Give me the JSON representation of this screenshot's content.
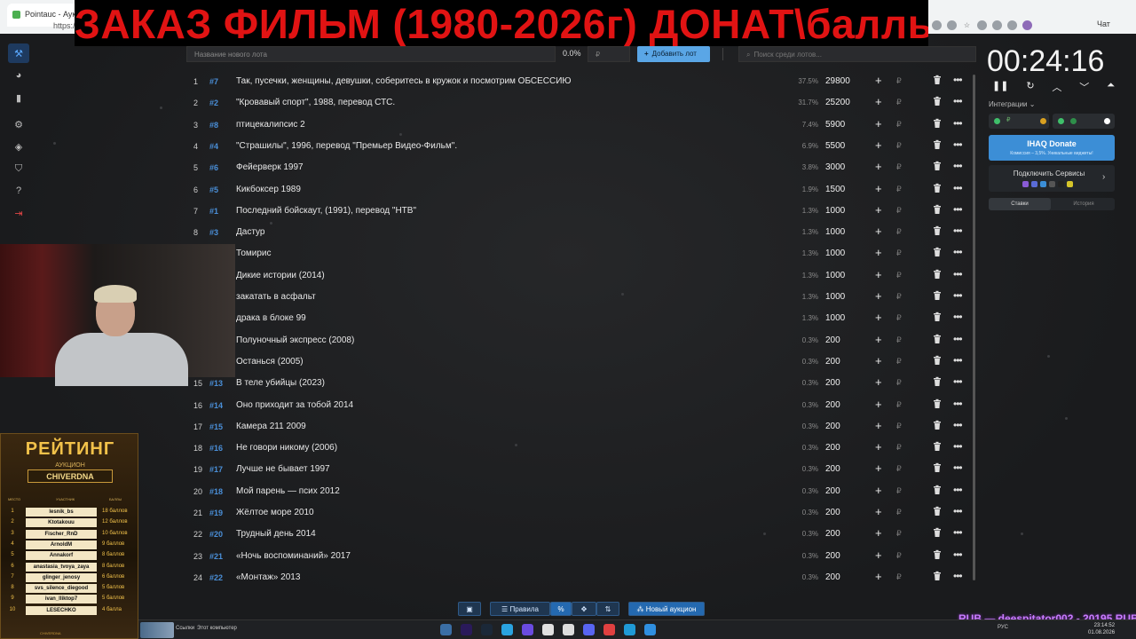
{
  "browser": {
    "tab_title": "Pointauc - Аукци",
    "url_fragment": "https://po",
    "chat_label": "Чат"
  },
  "banner": {
    "text": "ЗАКАЗ ФИЛЬМ (1980-2026г) ДОНАТ\\баллы"
  },
  "toolbar": {
    "lot_name_placeholder": "Название нового лота",
    "percent": "0.0%",
    "price_placeholder": "₽",
    "add_lot_label": "Добавить лот",
    "search_placeholder": "Поиск среди лотов..."
  },
  "lots": [
    {
      "num": "1",
      "fast_id": "#7",
      "name": "Так, пусечки, женщины, девушки, соберитесь в кружок и посмотрим ОБСЕССИЮ",
      "pct": "37.5%",
      "amount": "29800"
    },
    {
      "num": "2",
      "fast_id": "#2",
      "name": "\"Кровавый спорт\", 1988, перевод СТС.",
      "pct": "31.7%",
      "amount": "25200"
    },
    {
      "num": "3",
      "fast_id": "#8",
      "name": "птицекалипсис 2",
      "pct": "7.4%",
      "amount": "5900"
    },
    {
      "num": "4",
      "fast_id": "#4",
      "name": "\"Страшилы\", 1996, перевод \"Премьер Видео-Фильм\".",
      "pct": "6.9%",
      "amount": "5500"
    },
    {
      "num": "5",
      "fast_id": "#6",
      "name": "Фейерверк 1997",
      "pct": "3.8%",
      "amount": "3000"
    },
    {
      "num": "6",
      "fast_id": "#5",
      "name": "Кикбоксер 1989",
      "pct": "1.9%",
      "amount": "1500"
    },
    {
      "num": "7",
      "fast_id": "#1",
      "name": "Последний бойскаут, (1991), перевод \"НТВ\"",
      "pct": "1.3%",
      "amount": "1000"
    },
    {
      "num": "8",
      "fast_id": "#3",
      "name": "Дастур",
      "pct": "1.3%",
      "amount": "1000"
    },
    {
      "num": "",
      "fast_id": "",
      "name": "Томирис",
      "pct": "1.3%",
      "amount": "1000"
    },
    {
      "num": "",
      "fast_id": "",
      "name": "Дикие истории (2014)",
      "pct": "1.3%",
      "amount": "1000"
    },
    {
      "num": "",
      "fast_id": "",
      "name": "закатать в асфальт",
      "pct": "1.3%",
      "amount": "1000"
    },
    {
      "num": "",
      "fast_id": "",
      "name": "драка в блоке 99",
      "pct": "1.3%",
      "amount": "1000"
    },
    {
      "num": "",
      "fast_id": "",
      "name": "Полуночный экспресс (2008)",
      "pct": "0.3%",
      "amount": "200"
    },
    {
      "num": "",
      "fast_id": "",
      "name": "Останься (2005)",
      "pct": "0.3%",
      "amount": "200"
    },
    {
      "num": "15",
      "fast_id": "#13",
      "name": "В теле убийцы (2023)",
      "pct": "0.3%",
      "amount": "200"
    },
    {
      "num": "16",
      "fast_id": "#14",
      "name": "Оно приходит за тобой 2014",
      "pct": "0.3%",
      "amount": "200"
    },
    {
      "num": "17",
      "fast_id": "#15",
      "name": "Камера 211 2009",
      "pct": "0.3%",
      "amount": "200"
    },
    {
      "num": "18",
      "fast_id": "#16",
      "name": "Не говори никому (2006)",
      "pct": "0.3%",
      "amount": "200"
    },
    {
      "num": "19",
      "fast_id": "#17",
      "name": "Лучше не бывает 1997",
      "pct": "0.3%",
      "amount": "200"
    },
    {
      "num": "20",
      "fast_id": "#18",
      "name": "Мой парень — псих 2012",
      "pct": "0.3%",
      "amount": "200"
    },
    {
      "num": "21",
      "fast_id": "#19",
      "name": "Жёлтое море 2010",
      "pct": "0.3%",
      "amount": "200"
    },
    {
      "num": "22",
      "fast_id": "#20",
      "name": "Трудный день 2014",
      "pct": "0.3%",
      "amount": "200"
    },
    {
      "num": "23",
      "fast_id": "#21",
      "name": "«Ночь воспоминаний» 2017",
      "pct": "0.3%",
      "amount": "200"
    },
    {
      "num": "24",
      "fast_id": "#22",
      "name": "«Монтаж» 2013",
      "pct": "0.3%",
      "amount": "200"
    }
  ],
  "currency": "₽",
  "timer": "00:24:16",
  "integrations_label": "Интеграции",
  "donate": {
    "title": "IHAQ Donate",
    "subtitle": "Комиссия – 3,5%. Уникальные виджеты!"
  },
  "connect_services": "Подключить Сервисы",
  "right_tabs": [
    "Ставки",
    "История"
  ],
  "bottom": {
    "rules": "Правила",
    "new_auction": "Новый аукцион"
  },
  "rating": {
    "title": "РЕЙТИНГ",
    "subtitle": "АУКЦИОН",
    "channel": "CHIVERDNA",
    "headers": [
      "МЕСТО",
      "УЧАСТНИК",
      "БАЛЛЫ"
    ],
    "footer": "CHIVERDNA",
    "rows": [
      {
        "place": "1",
        "name": "lesnik_bs",
        "score": "18 баллов"
      },
      {
        "place": "2",
        "name": "Ktotakouu",
        "score": "12 баллов"
      },
      {
        "place": "3",
        "name": "Fischer_RnD",
        "score": "10 баллов"
      },
      {
        "place": "4",
        "name": "ArnoldM",
        "score": "9 баллов"
      },
      {
        "place": "5",
        "name": "Annakorf",
        "score": "8 баллов"
      },
      {
        "place": "6",
        "name": "anastasia_tvoya_zaya",
        "score": "8 баллов"
      },
      {
        "place": "7",
        "name": "glinger_jenosy",
        "score": "6 баллов"
      },
      {
        "place": "8",
        "name": "svs_silence_diegood",
        "score": "5 баллов"
      },
      {
        "place": "9",
        "name": "ivan_lliktop7",
        "score": "5 баллов"
      },
      {
        "place": "10",
        "name": "LESECHKO",
        "score": "4 балла"
      }
    ]
  },
  "overlay_donor": "RUB — deespitator002 - 20195 RUB",
  "taskbar": {
    "links": "Ссылки",
    "this_pc": "Этот компьютер",
    "lang": "РУС",
    "time": "23:14:52",
    "date": "01.08.2026"
  }
}
